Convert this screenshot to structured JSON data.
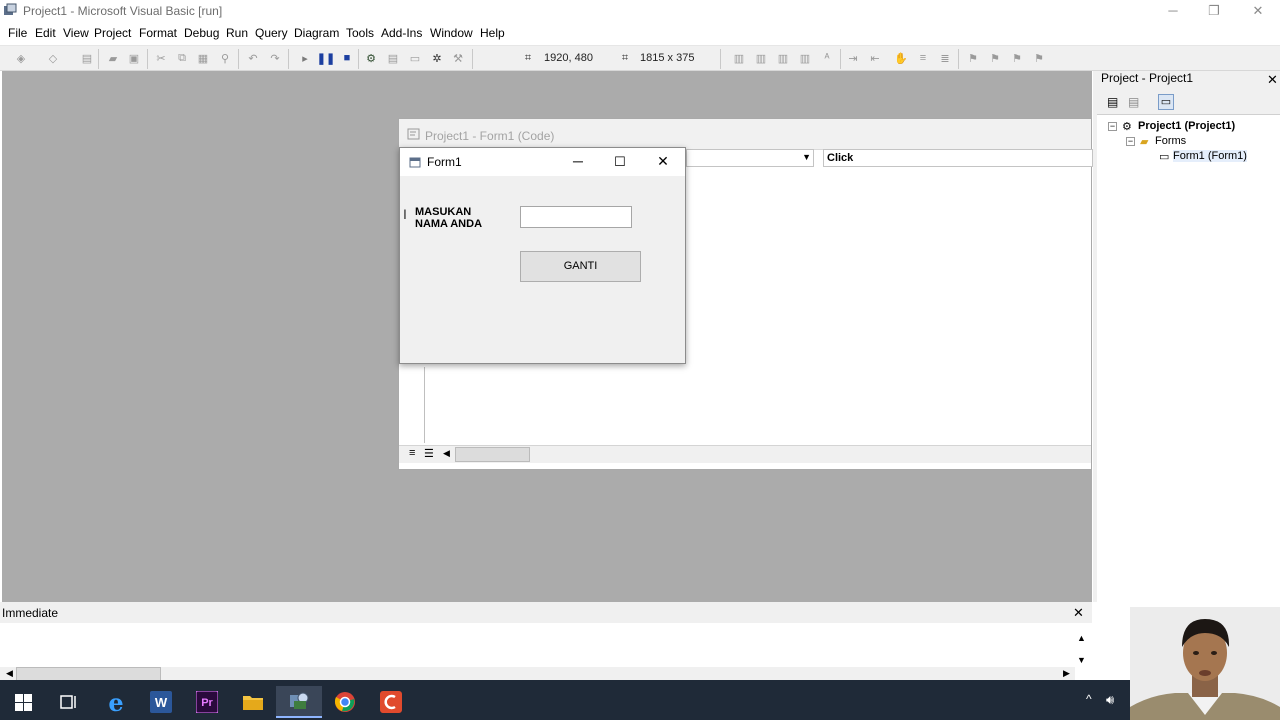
{
  "window": {
    "title": "Project1 - Microsoft Visual Basic [run]",
    "controls": {
      "minimize": "─",
      "restore": "❐",
      "close": "✕"
    }
  },
  "menu": [
    "File",
    "Edit",
    "View",
    "Project",
    "Format",
    "Debug",
    "Run",
    "Query",
    "Diagram",
    "Tools",
    "Add-Ins",
    "Window",
    "Help"
  ],
  "toolbar": {
    "position": "1920, 480",
    "size": "1815 x 375"
  },
  "code_window": {
    "title": "Project1 - Form1 (Code)",
    "procedure": "Click"
  },
  "form1": {
    "title": "Form1",
    "label_line1": "MASUKAN",
    "label_line2": "NAMA ANDA",
    "textbox_value": "",
    "button_label": "GANTI"
  },
  "project_panel": {
    "title": "Project - Project1",
    "tree": {
      "project": "Project1 (Project1)",
      "folder": "Forms",
      "form": "Form1 (Form1)"
    }
  },
  "immediate": {
    "title": "Immediate"
  },
  "taskbar": {
    "apps": [
      "windows-start",
      "task-view",
      "edge",
      "word",
      "premiere",
      "file-explorer",
      "vb6",
      "chrome",
      "screen-recorder"
    ]
  },
  "colors": {
    "workspace": "#ababab",
    "taskbar": "#1f2a38",
    "word_blue": "#2b579a",
    "premiere_purple": "#2a0a3c",
    "recorder_red": "#e04a2d"
  }
}
